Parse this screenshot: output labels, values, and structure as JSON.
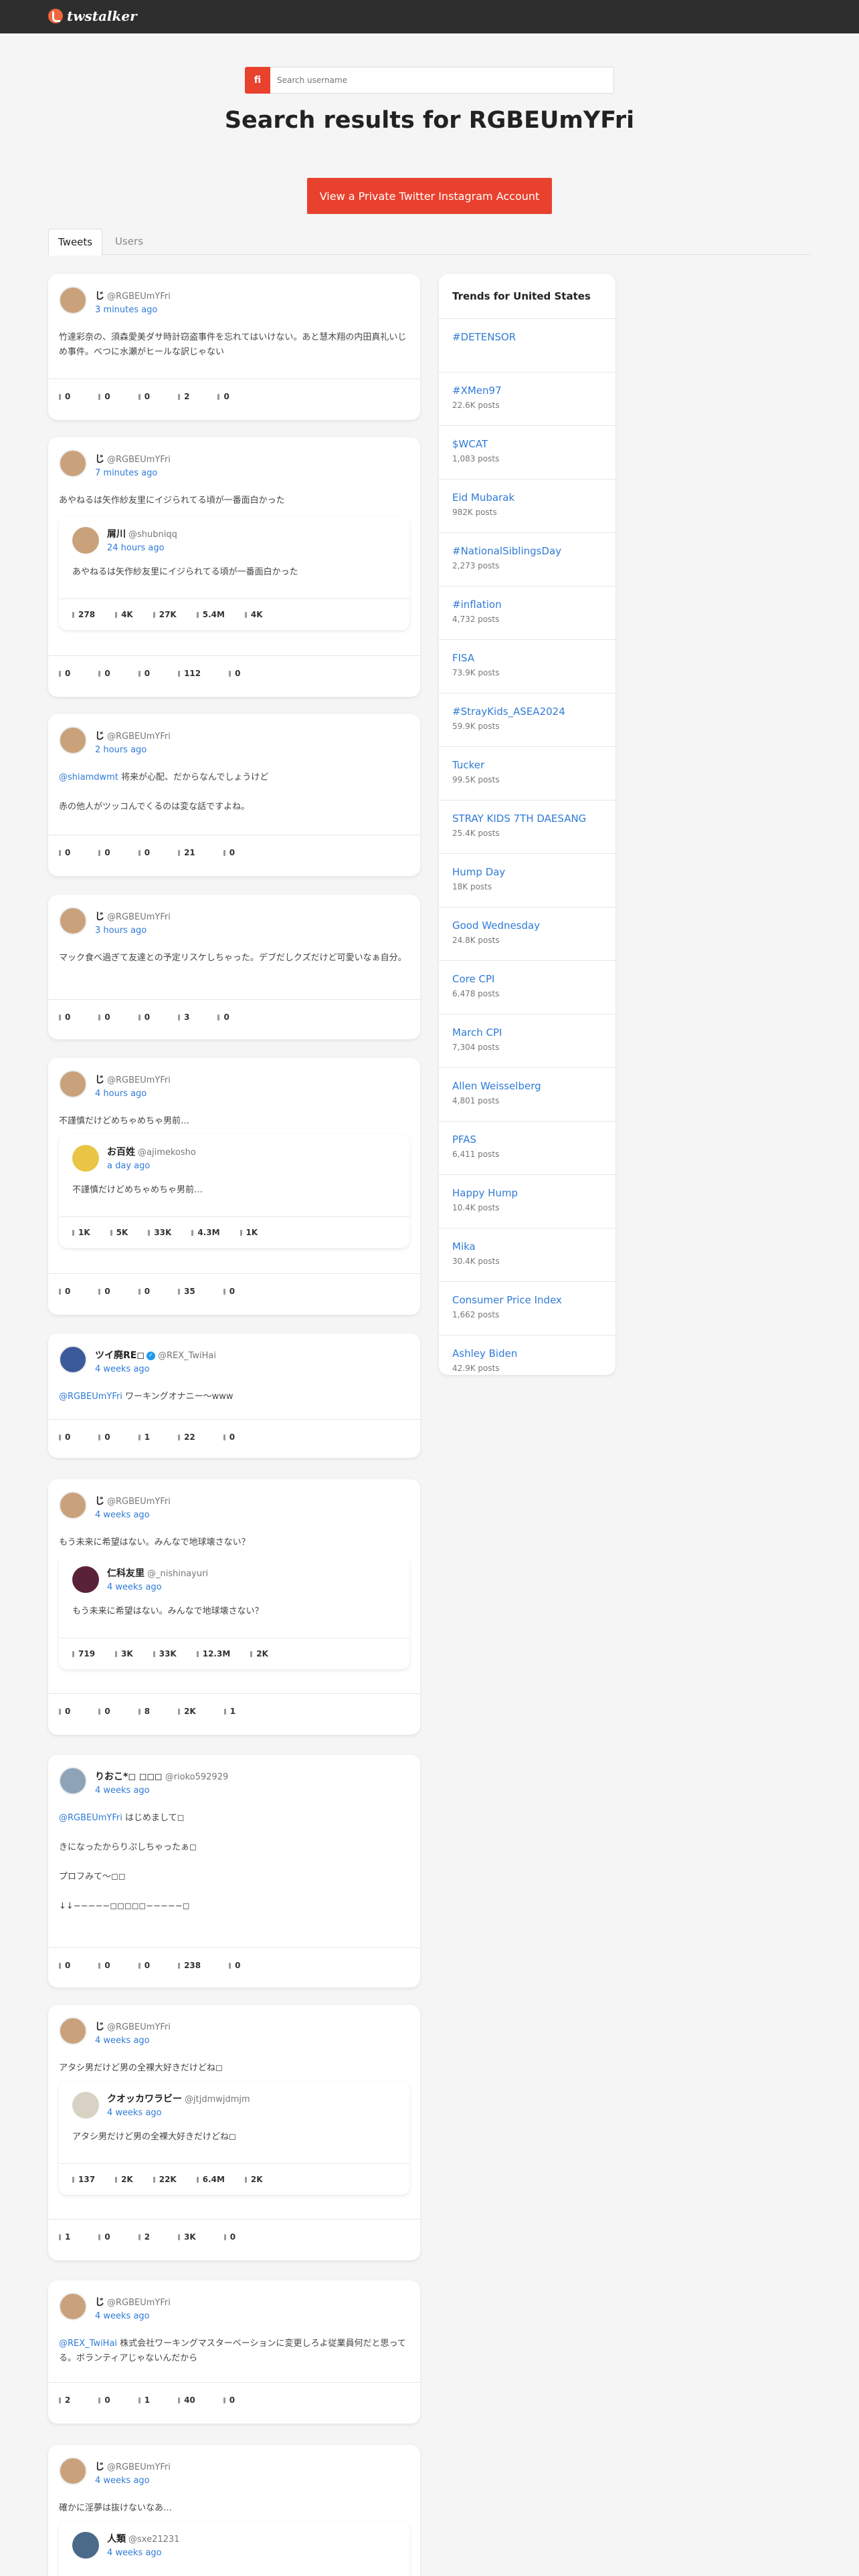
{
  "header": {
    "logo": "twstalker"
  },
  "search": {
    "button": "fi",
    "placeholder": "Search username"
  },
  "title": "Search results for RGBEUmYFri",
  "cta": "View a Private Twitter Instagram Account",
  "tabs": [
    "Tweets",
    "Users"
  ],
  "tweets": [
    {
      "name": "じ",
      "handle": "@RGBEUmYFri",
      "time": "3 minutes ago",
      "text": "竹達彩奈の、須森愛美ダサ時計窃盗事件を忘れてはいけない。あと慧木翔の内田真礼いじめ事件。べつに水瀬がヒールな訳じゃない",
      "stats": [
        "0",
        "0",
        "0",
        "2",
        "0"
      ]
    },
    {
      "name": "じ",
      "handle": "@RGBEUmYFri",
      "time": "7 minutes ago",
      "text": "あやねるは矢作紗友里にイジられてる頃が一番面白かった",
      "quote": {
        "name": "屑川",
        "handle": "@shubniqq",
        "time": "24 hours ago",
        "text": "あやねるは矢作紗友里にイジられてる頃が一番面白かった",
        "stats": [
          "278",
          "4K",
          "27K",
          "5.4M",
          "4K"
        ]
      },
      "stats": [
        "0",
        "0",
        "0",
        "112",
        "0"
      ]
    },
    {
      "name": "じ",
      "handle": "@RGBEUmYFri",
      "time": "2 hours ago",
      "mention": "@shiamdwmt",
      "text": " 将来が心配、だからなんでしょうけど\n\n赤の他人がツッコんでくるのは変な話ですよね。",
      "stats": [
        "0",
        "0",
        "0",
        "21",
        "0"
      ]
    },
    {
      "name": "じ",
      "handle": "@RGBEUmYFri",
      "time": "3 hours ago",
      "text": "マック食べ過ぎて友達との予定リスケしちゃった。デブだしクズだけど可愛いなぁ自分。",
      "stats": [
        "0",
        "0",
        "0",
        "3",
        "0"
      ]
    },
    {
      "name": "じ",
      "handle": "@RGBEUmYFri",
      "time": "4 hours ago",
      "text": "不謹慎だけどめちゃめちゃ男前…",
      "quote": {
        "name": "お百姓",
        "handle": "@ajimekosho",
        "time": "a day ago",
        "text": "不謹慎だけどめちゃめちゃ男前…",
        "stats": [
          "1K",
          "5K",
          "33K",
          "4.3M",
          "1K"
        ]
      },
      "stats": [
        "0",
        "0",
        "0",
        "35",
        "0"
      ]
    },
    {
      "name": "ツイ廃RE◻",
      "handle": "@REX_TwiHai",
      "time": "4 weeks ago",
      "mention": "@RGBEUmYFri",
      "text": " ワーキングオナニー〜www",
      "stats": [
        "0",
        "0",
        "1",
        "22",
        "0"
      ]
    },
    {
      "name": "じ",
      "handle": "@RGBEUmYFri",
      "time": "4 weeks ago",
      "text": "もう未来に希望はない。みんなで地球壊さない？",
      "quote": {
        "name": "仁科友里",
        "handle": "@_nishinayuri",
        "time": "4 weeks ago",
        "text": "もう未来に希望はない。みんなで地球壊さない？",
        "stats": [
          "719",
          "3K",
          "33K",
          "12.3M",
          "2K"
        ]
      },
      "stats": [
        "0",
        "0",
        "8",
        "2K",
        "1"
      ]
    },
    {
      "name": "りおこ*◻ ◻◻◻",
      "handle": "@rioko592929",
      "time": "4 weeks ago",
      "mention": "@RGBEUmYFri",
      "text": " はじめまして◻\n\nきになったからりぷしちゃったぁ◻\n\nプロフみて〜◻◻\n\n↓↓−−−−−◻◻◻◻◻−−−−−◻",
      "stats": [
        "0",
        "0",
        "0",
        "238",
        "0"
      ]
    },
    {
      "name": "じ",
      "handle": "@RGBEUmYFri",
      "time": "4 weeks ago",
      "text": "アタシ男だけど男の全裸大好きだけどね◻",
      "quote": {
        "name": "クオッカワラビー",
        "handle": "@jtjdmwjdmjm",
        "time": "4 weeks ago",
        "text": "アタシ男だけど男の全裸大好きだけどね◻",
        "stats": [
          "137",
          "2K",
          "22K",
          "6.4M",
          "2K"
        ]
      },
      "stats": [
        "1",
        "0",
        "2",
        "3K",
        "0"
      ]
    },
    {
      "name": "じ",
      "handle": "@RGBEUmYFri",
      "time": "4 weeks ago",
      "mention": "@REX_TwiHai",
      "text": " 株式会社ワーキングマスターベーションに変更しろよ従業員何だと思ってる。ボランティアじゃないんだから",
      "stats": [
        "2",
        "0",
        "1",
        "40",
        "0"
      ]
    },
    {
      "name": "じ",
      "handle": "@RGBEUmYFri",
      "time": "4 weeks ago",
      "text": "確かに淫夢は抜けないなあ…",
      "quote": {
        "name": "人類",
        "handle": "@sxe21231",
        "time": "4 weeks ago",
        "text": "",
        "stats": []
      },
      "stats": []
    }
  ],
  "trends_title": "Trends for United States",
  "trends": [
    {
      "name": "#DETENSOR",
      "count": ""
    },
    {
      "name": "#XMen97",
      "count": "22.6K posts"
    },
    {
      "name": "$WCAT",
      "count": "1,083 posts"
    },
    {
      "name": "Eid Mubarak",
      "count": "982K posts"
    },
    {
      "name": "#NationalSiblingsDay",
      "count": "2,273 posts"
    },
    {
      "name": "#inflation",
      "count": "4,732 posts"
    },
    {
      "name": "FISA",
      "count": "73.9K posts"
    },
    {
      "name": "#StrayKids_ASEA2024",
      "count": "59.9K posts"
    },
    {
      "name": "Tucker",
      "count": "99.5K posts"
    },
    {
      "name": "STRAY KIDS 7TH DAESANG",
      "count": "25.4K posts"
    },
    {
      "name": "Hump Day",
      "count": "18K posts"
    },
    {
      "name": "Good Wednesday",
      "count": "24.8K posts"
    },
    {
      "name": "Core CPI",
      "count": "6,478 posts"
    },
    {
      "name": "March CPI",
      "count": "7,304 posts"
    },
    {
      "name": "Allen Weisselberg",
      "count": "4,801 posts"
    },
    {
      "name": "PFAS",
      "count": "6,411 posts"
    },
    {
      "name": "Happy Hump",
      "count": "10.4K posts"
    },
    {
      "name": "Mika",
      "count": "30.4K posts"
    },
    {
      "name": "Consumer Price Index",
      "count": "1,662 posts"
    },
    {
      "name": "Ashley Biden",
      "count": "42.9K posts"
    }
  ]
}
